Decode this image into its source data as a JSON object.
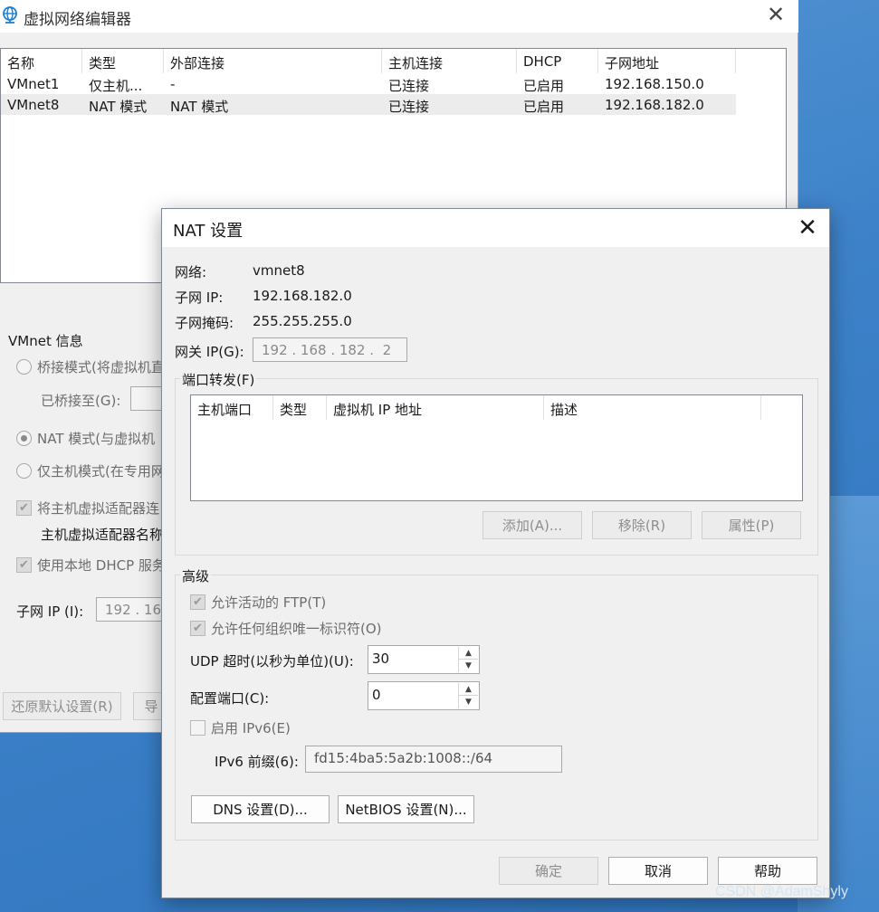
{
  "main_window": {
    "title": "虚拟网络编辑器",
    "columns": [
      "名称",
      "类型",
      "外部连接",
      "主机连接",
      "DHCP",
      "子网地址"
    ],
    "rows": [
      [
        "VMnet1",
        "仅主机...",
        "-",
        "已连接",
        "已启用",
        "192.168.150.0"
      ],
      [
        "VMnet8",
        "NAT 模式",
        "NAT 模式",
        "已连接",
        "已启用",
        "192.168.182.0"
      ]
    ],
    "selected_row": "VMnet8",
    "vmnet_info_title": "VMnet 信息",
    "bridge_mode": "桥接模式(将虚拟机直",
    "bridged_to": "已桥接至(G):",
    "nat_mode": "NAT 模式(与虚拟机",
    "host_only_mode": "仅主机模式(在专用网",
    "connect_adapter": "将主机虚拟适配器连",
    "adapter_name": "主机虚拟适配器名称",
    "use_dhcp": "使用本地 DHCP 服务",
    "subnet_ip_label": "子网 IP (I):",
    "subnet_ip_value": "192 . 168",
    "restore_defaults": "还原默认设置(R)",
    "import_partial": "导"
  },
  "nat_dialog": {
    "title": "NAT 设置",
    "network_label": "网络:",
    "network_value": "vmnet8",
    "subnet_ip_label": "子网 IP:",
    "subnet_ip_value": "192.168.182.0",
    "subnet_mask_label": "子网掩码:",
    "subnet_mask_value": "255.255.255.0",
    "gateway_label": "网关 IP(G):",
    "gateway_value": "192 . 168 . 182 .  2",
    "port_forwarding_title": "端口转发(F)",
    "pf_columns": [
      "主机端口",
      "类型",
      "虚拟机 IP 地址",
      "描述"
    ],
    "add_button": "添加(A)...",
    "remove_button": "移除(R)",
    "properties_button": "属性(P)",
    "advanced_title": "高级",
    "allow_ftp": "允许活动的 FTP(T)",
    "allow_oui": "允许任何组织唯一标识符(O)",
    "udp_timeout_label": "UDP 超时(以秒为单位)(U):",
    "udp_timeout_value": "30",
    "config_port_label": "配置端口(C):",
    "config_port_value": "0",
    "enable_ipv6": "启用 IPv6(E)",
    "ipv6_prefix_label": "IPv6 前缀(6):",
    "ipv6_prefix_value": "fd15:4ba5:5a2b:1008::/64",
    "dns_button": "DNS 设置(D)...",
    "netbios_button": "NetBIOS 设置(N)...",
    "ok_button": "确定",
    "cancel_button": "取消",
    "help_button": "帮助"
  },
  "watermark": "CSDN @AdamShyly",
  "colors": {
    "desktop": "#3d82c9",
    "dialog_bg": "#f0f0f0",
    "disabled_text": "#8e8e8e"
  }
}
